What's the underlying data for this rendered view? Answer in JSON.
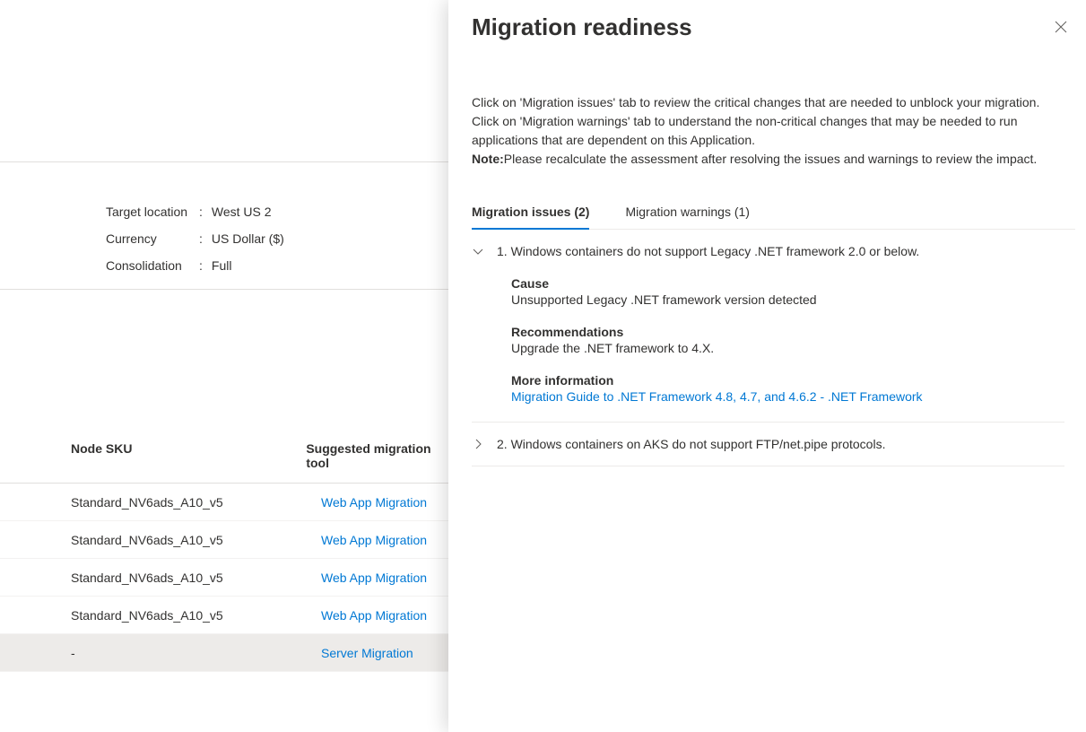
{
  "left": {
    "props": [
      {
        "label": "Target location",
        "value": "West US 2"
      },
      {
        "label": "Currency",
        "value": "US Dollar ($)"
      },
      {
        "label": "Consolidation",
        "value": "Full"
      }
    ],
    "table": {
      "headers": {
        "sku": "Node SKU",
        "tool": "Suggested migration tool"
      },
      "rows": [
        {
          "sku": "Standard_NV6ads_A10_v5",
          "tool": "Web App Migration",
          "selected": false
        },
        {
          "sku": "Standard_NV6ads_A10_v5",
          "tool": "Web App Migration",
          "selected": false
        },
        {
          "sku": "Standard_NV6ads_A10_v5",
          "tool": "Web App Migration",
          "selected": false
        },
        {
          "sku": "Standard_NV6ads_A10_v5",
          "tool": "Web App Migration",
          "selected": false
        },
        {
          "sku": "-",
          "tool": "Server Migration",
          "selected": true
        }
      ]
    }
  },
  "panel": {
    "title": "Migration readiness",
    "desc_part1": "Click on 'Migration issues' tab to review the critical changes that are needed to unblock your migration. Click on 'Migration warnings' tab to understand the non-critical changes that may be needed to run applications that are dependent on this Application.",
    "note_label": "Note:",
    "note_text": "Please recalculate the assessment after resolving the issues and warnings to review the impact.",
    "tabs": {
      "issues": "Migration issues (2)",
      "warnings": "Migration warnings (1)"
    },
    "issues": [
      {
        "expanded": true,
        "title": "1. Windows containers do not support Legacy .NET framework 2.0 or below.",
        "cause_label": "Cause",
        "cause": "Unsupported Legacy .NET framework version detected",
        "rec_label": "Recommendations",
        "rec": "Upgrade the .NET framework to 4.X.",
        "more_label": "More information",
        "more_link": "Migration Guide to .NET Framework 4.8, 4.7, and 4.6.2 - .NET Framework"
      },
      {
        "expanded": false,
        "title": "2. Windows containers on AKS do not support FTP/net.pipe protocols."
      }
    ]
  }
}
